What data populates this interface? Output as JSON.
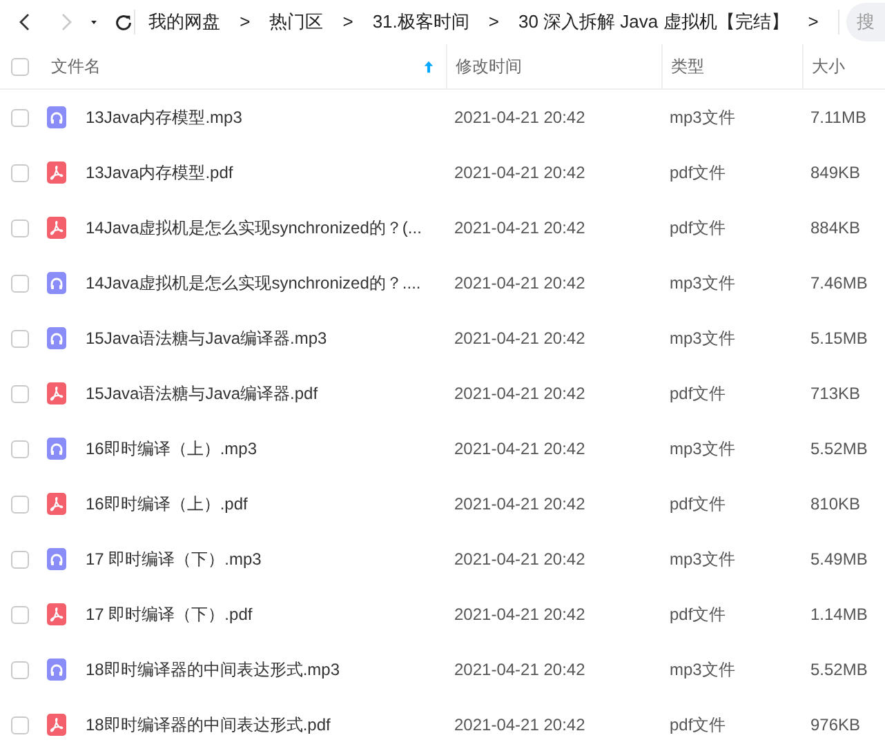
{
  "nav": {
    "back_disabled": false,
    "forward_disabled": true
  },
  "breadcrumbs": [
    {
      "label": "我的网盘",
      "separator": ">"
    },
    {
      "label": "热门区",
      "separator": ">"
    },
    {
      "label": "31.极客时间",
      "separator": ">"
    },
    {
      "label": "30 深入拆解 Java 虚拟机【完结】",
      "separator": ">"
    }
  ],
  "search": {
    "placeholder": "搜"
  },
  "table": {
    "columns": [
      {
        "label": "文件名",
        "sorted": true
      },
      {
        "label": "修改时间",
        "sorted": false
      },
      {
        "label": "类型",
        "sorted": false
      },
      {
        "label": "大小",
        "sorted": false
      }
    ],
    "all_checked": false,
    "rows": [
      {
        "kind": "mp3",
        "name": "13Java内存模型.mp3",
        "modified": "2021-04-21 20:42",
        "type": "mp3文件",
        "size": "7.11MB",
        "checked": false
      },
      {
        "kind": "pdf",
        "name": "13Java内存模型.pdf",
        "modified": "2021-04-21 20:42",
        "type": "pdf文件",
        "size": "849KB",
        "checked": false
      },
      {
        "kind": "pdf",
        "name": "14Java虚拟机是怎么实现synchronized的？(...",
        "modified": "2021-04-21 20:42",
        "type": "pdf文件",
        "size": "884KB",
        "checked": false
      },
      {
        "kind": "mp3",
        "name": "14Java虚拟机是怎么实现synchronized的？....",
        "modified": "2021-04-21 20:42",
        "type": "mp3文件",
        "size": "7.46MB",
        "checked": false
      },
      {
        "kind": "mp3",
        "name": "15Java语法糖与Java编译器.mp3",
        "modified": "2021-04-21 20:42",
        "type": "mp3文件",
        "size": "5.15MB",
        "checked": false
      },
      {
        "kind": "pdf",
        "name": "15Java语法糖与Java编译器.pdf",
        "modified": "2021-04-21 20:42",
        "type": "pdf文件",
        "size": "713KB",
        "checked": false
      },
      {
        "kind": "mp3",
        "name": "16即时编译（上）.mp3",
        "modified": "2021-04-21 20:42",
        "type": "mp3文件",
        "size": "5.52MB",
        "checked": false
      },
      {
        "kind": "pdf",
        "name": "16即时编译（上）.pdf",
        "modified": "2021-04-21 20:42",
        "type": "pdf文件",
        "size": "810KB",
        "checked": false
      },
      {
        "kind": "mp3",
        "name": "17 即时编译（下）.mp3",
        "modified": "2021-04-21 20:42",
        "type": "mp3文件",
        "size": "5.49MB",
        "checked": false
      },
      {
        "kind": "pdf",
        "name": "17 即时编译（下）.pdf",
        "modified": "2021-04-21 20:42",
        "type": "pdf文件",
        "size": "1.14MB",
        "checked": false
      },
      {
        "kind": "mp3",
        "name": "18即时编译器的中间表达形式.mp3",
        "modified": "2021-04-21 20:42",
        "type": "mp3文件",
        "size": "5.52MB",
        "checked": false
      },
      {
        "kind": "pdf",
        "name": "18即时编译器的中间表达形式.pdf",
        "modified": "2021-04-21 20:42",
        "type": "pdf文件",
        "size": "976KB",
        "checked": false
      }
    ]
  }
}
